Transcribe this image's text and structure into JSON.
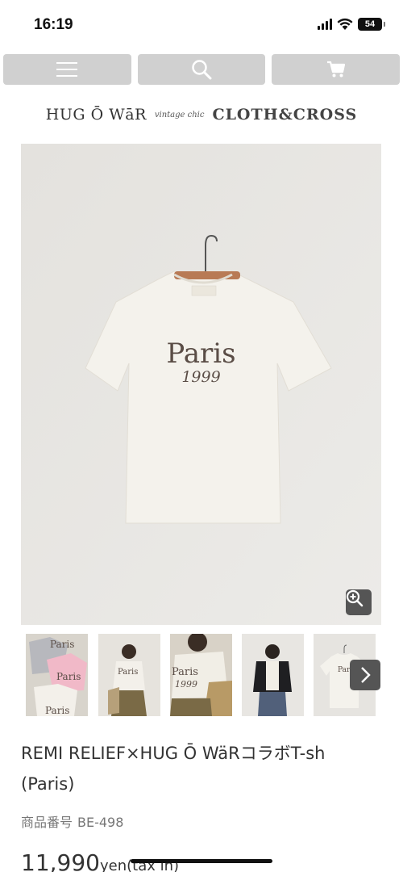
{
  "status_bar": {
    "time": "16:19",
    "battery": "54",
    "signal_icon": "cellular-signal-icon",
    "wifi_icon": "wifi-icon"
  },
  "nav": {
    "menu_icon": "hamburger-menu-icon",
    "search_icon": "search-icon",
    "cart_icon": "shopping-cart-icon",
    "button_color": "#d0d0d0"
  },
  "brand": {
    "logo_left": "HUG Ō WāR",
    "logo_script": "vintage chic",
    "logo_right": "CLOTH&CROSS"
  },
  "gallery": {
    "main_shirt_print_line1": "Paris",
    "main_shirt_print_line2": "1999",
    "zoom_icon": "zoom-in-icon",
    "thumbnails": [
      {
        "label_1": "Paris",
        "label_2": "Paris",
        "label_3": "Paris"
      },
      {
        "label_1": "Paris"
      },
      {
        "label_1": "Paris",
        "label_2": "1999"
      },
      {},
      {
        "label_1": "Paris"
      }
    ],
    "next_icon": "chevron-right-icon"
  },
  "product": {
    "name": "REMI RELIEF×HUG Ō WäRコラボT-sh (Paris)",
    "code_label": "商品番号",
    "code_value": "BE-498",
    "price_value": "11,990",
    "price_unit": "yen(tax in)"
  }
}
